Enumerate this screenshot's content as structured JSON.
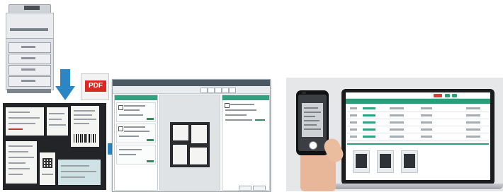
{
  "pdf_badge": {
    "label": "PDF",
    "color": "#d9281f"
  },
  "icons": {
    "arrow_down": "arrow-down-icon",
    "arrow_right": "arrow-right-icon",
    "copier": "copier-icon",
    "smartphone": "smartphone-icon",
    "laptop": "laptop-icon"
  },
  "colors": {
    "accent_teal": "#2c9d7a",
    "arrow_blue": "#2b86c5",
    "alert_red": "#d93b3b"
  }
}
